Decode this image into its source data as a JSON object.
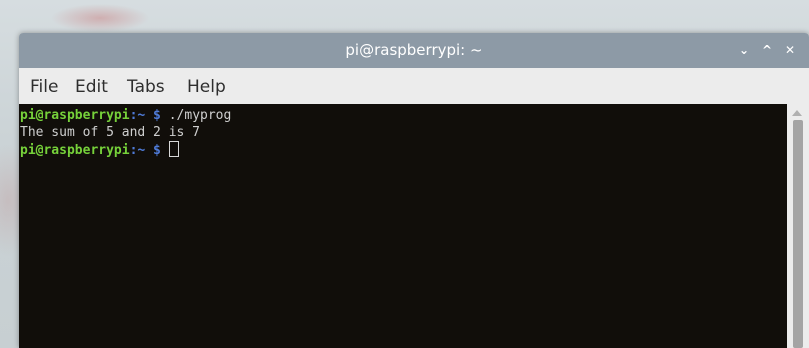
{
  "window": {
    "title": "pi@raspberrypi: ~",
    "controls": {
      "minimize_glyph": "⌄",
      "maximize_glyph": "^",
      "close_glyph": "✕"
    }
  },
  "menubar": {
    "items": [
      {
        "label": "File"
      },
      {
        "label": "Edit"
      },
      {
        "label": "Tabs"
      },
      {
        "label": "Help"
      }
    ]
  },
  "terminal": {
    "lines": [
      {
        "user": "pi@raspberrypi",
        "sep": ":",
        "path": "~",
        "sym": " $",
        "cmd": " ./myprog"
      },
      {
        "output": "The sum of 5 and 2 is 7"
      },
      {
        "user": "pi@raspberrypi",
        "sep": ":",
        "path": "~",
        "sym": " $",
        "cmd": " "
      }
    ],
    "colors": {
      "background": "#110e0a",
      "user": "#76d13a",
      "path": "#4f7bd8",
      "text": "#cfcfcf"
    }
  }
}
